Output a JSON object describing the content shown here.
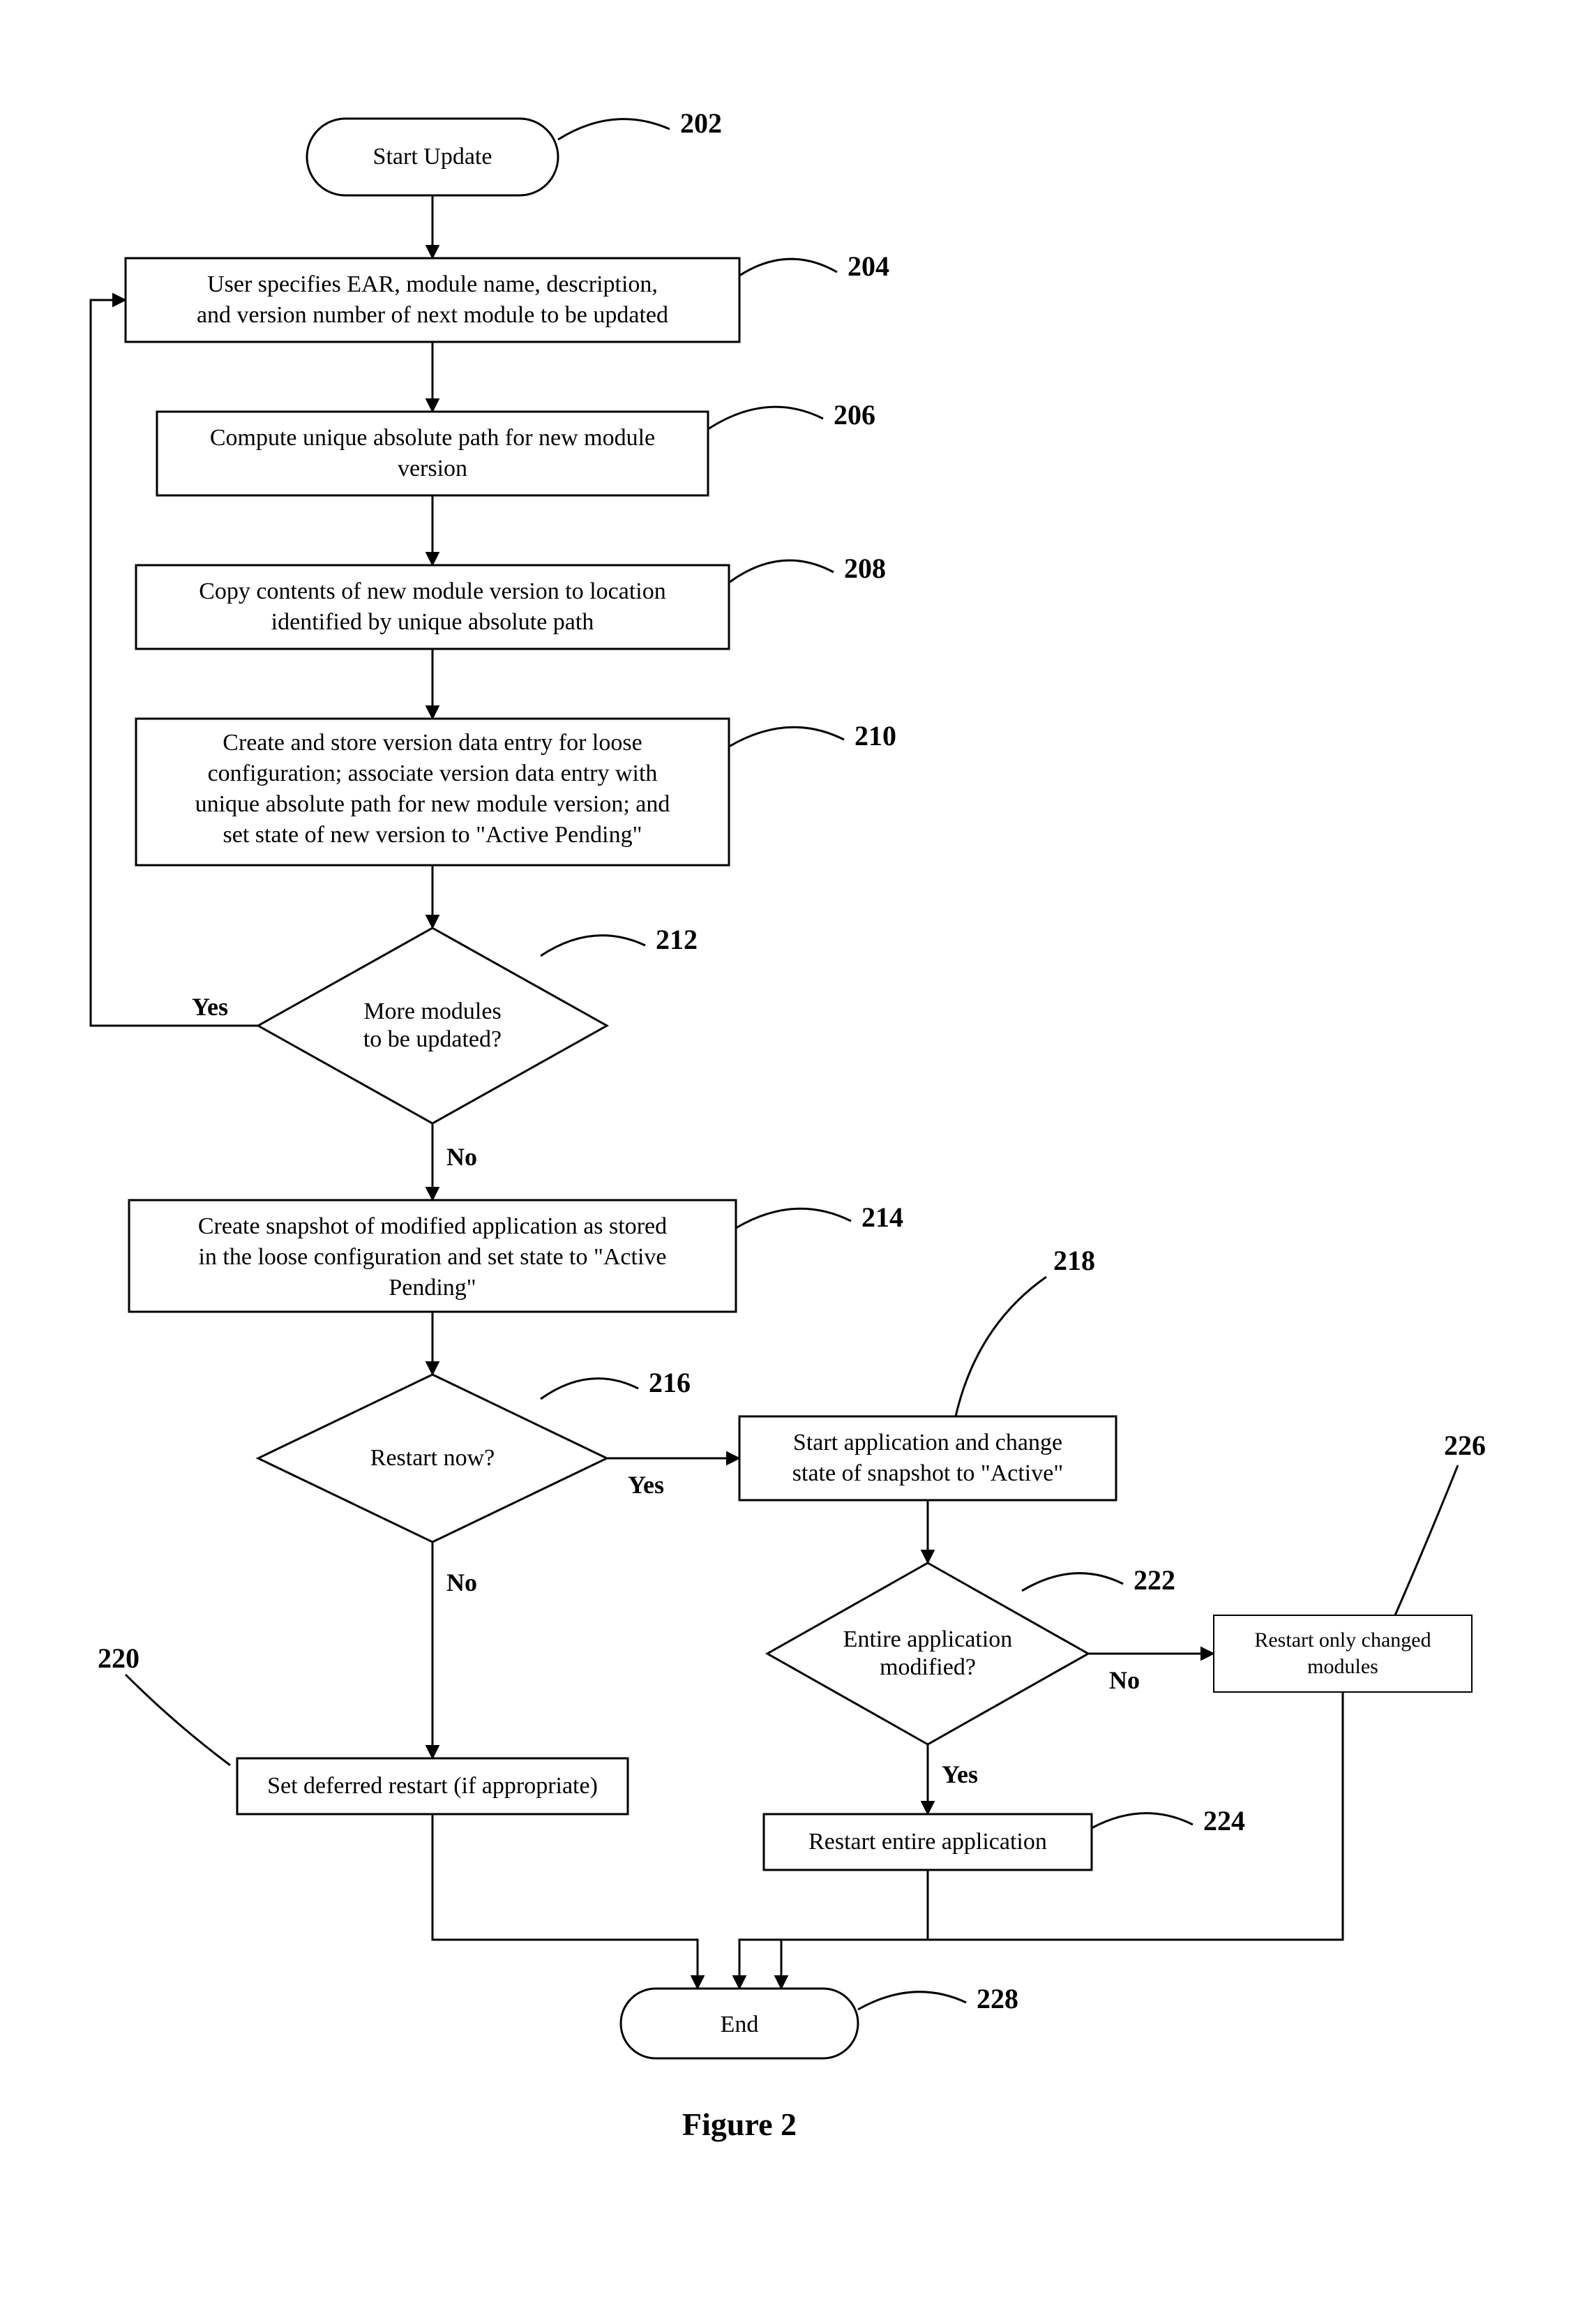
{
  "figureCaption": "Figure 2",
  "nodes": {
    "n202": {
      "ref": "202",
      "text": "Start Update"
    },
    "n204": {
      "ref": "204",
      "text1": "User specifies EAR, module name, description,",
      "text2": "and version number of next module to be updated"
    },
    "n206": {
      "ref": "206",
      "text1": "Compute unique absolute path for new module",
      "text2": "version"
    },
    "n208": {
      "ref": "208",
      "text1": "Copy contents of new module version to location",
      "text2": "identified by unique absolute path"
    },
    "n210": {
      "ref": "210",
      "text1": "Create and store version data entry for loose",
      "text2": "configuration; associate version data entry with",
      "text3": "unique absolute path for new module version; and",
      "text4": "set state of new version to \"Active Pending\""
    },
    "n212": {
      "ref": "212",
      "text1": "More modules",
      "text2": "to be updated?"
    },
    "n214": {
      "ref": "214",
      "text1": "Create snapshot of modified application as stored",
      "text2": "in the loose configuration and set state to \"Active",
      "text3": "Pending\""
    },
    "n216": {
      "ref": "216",
      "text": "Restart now?"
    },
    "n218": {
      "ref": "218",
      "text1": "Start application and change",
      "text2": "state of snapshot to \"Active\""
    },
    "n220": {
      "ref": "220",
      "text": "Set deferred restart (if appropriate)"
    },
    "n222": {
      "ref": "222",
      "text1": "Entire application",
      "text2": "modified?"
    },
    "n224": {
      "ref": "224",
      "text": "Restart entire application"
    },
    "n226": {
      "ref": "226",
      "text1": "Restart only changed",
      "text2": "modules"
    },
    "n228": {
      "ref": "228",
      "text": "End"
    }
  },
  "edgeLabels": {
    "yes212": "Yes",
    "no212": "No",
    "yes216": "Yes",
    "no216": "No",
    "yes222": "Yes",
    "no222": "No"
  }
}
